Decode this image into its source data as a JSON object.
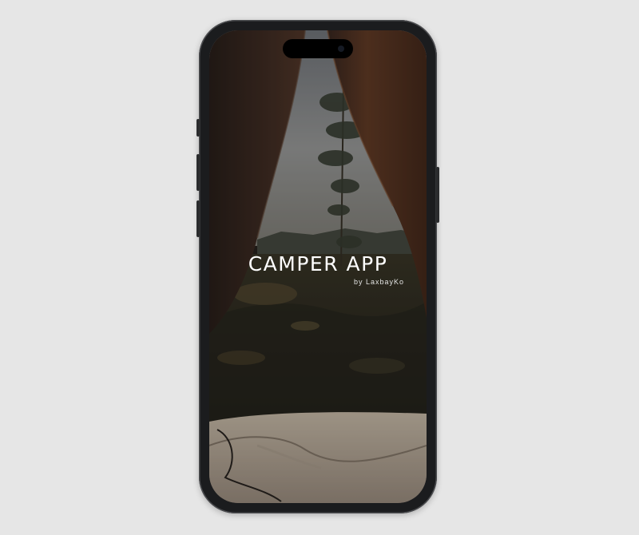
{
  "app": {
    "title": "CAMPER APP",
    "subtitle": "by LaxbayKo"
  },
  "colors": {
    "background": "#e6e6e6",
    "phone_frame": "#1b1c1e",
    "title_text": "#ffffff"
  },
  "icons": {
    "camera": "front-camera-icon"
  }
}
